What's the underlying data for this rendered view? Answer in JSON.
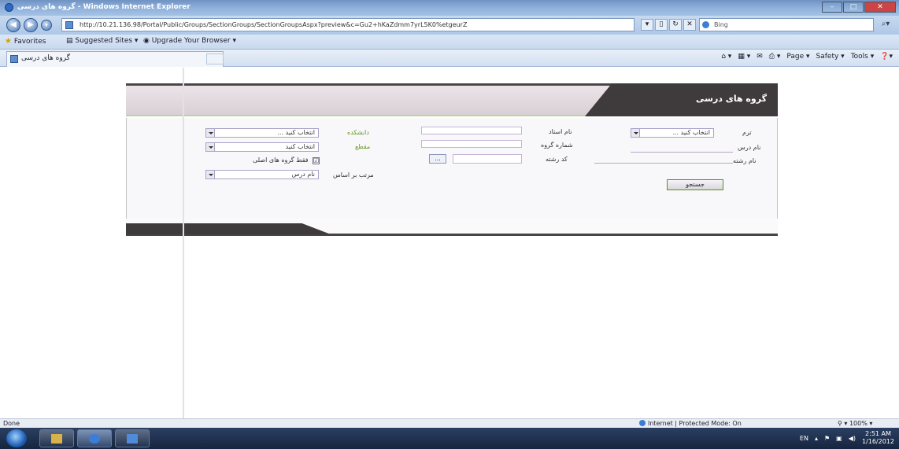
{
  "browser": {
    "title": "گروه های درسی - Windows Internet Explorer",
    "url": "http://10.21.136.98/Portal/Public/Groups/SectionGroups/SectionGroupsAspx?preview&c=Gu2+hKaZdmm7yrL5K0%etgeurZ",
    "search_placeholder": "Bing",
    "favorites_label": "Favorites",
    "suggested_sites": "Suggested Sites ▾",
    "upgrade_browser": "Upgrade Your Browser ▾",
    "tab_title": "گروه های درسی",
    "cmd_page": "Page ▾",
    "cmd_safety": "Safety ▾",
    "cmd_tools": "Tools ▾"
  },
  "panel": {
    "title": "گروه های درسی"
  },
  "form": {
    "term_label": "ترم",
    "term_value": "انتخاب کنید ...",
    "teacher_name_label": "نام استاد",
    "faculty_label": "دانشکده",
    "faculty_value": "انتخاب کنید ...",
    "course_name_label": "نام درس",
    "group_number_label": "شماره گروه",
    "level_label": "مقطع",
    "level_value": "انتخاب کنید",
    "major_name_label": "نام رشته",
    "major_code_label": "کد رشته",
    "browse_label": "...",
    "main_groups_only_label": "فقط گروه های اصلی",
    "main_groups_only_checked": "☑",
    "sort_by_label": "مرتب بر اساس",
    "sort_by_value": "نام درس",
    "search_button": "جستجو"
  },
  "status": {
    "left": "Done",
    "zone": "Internet | Protected Mode: On",
    "zoom": "100%"
  },
  "tray": {
    "lang": "EN",
    "time": "2:51 AM",
    "date": "1/16/2012"
  },
  "colors": {
    "accent_green": "#6a9d2d",
    "header_dark": "#3f3b3d",
    "taskbar": "#1d2d4b"
  }
}
